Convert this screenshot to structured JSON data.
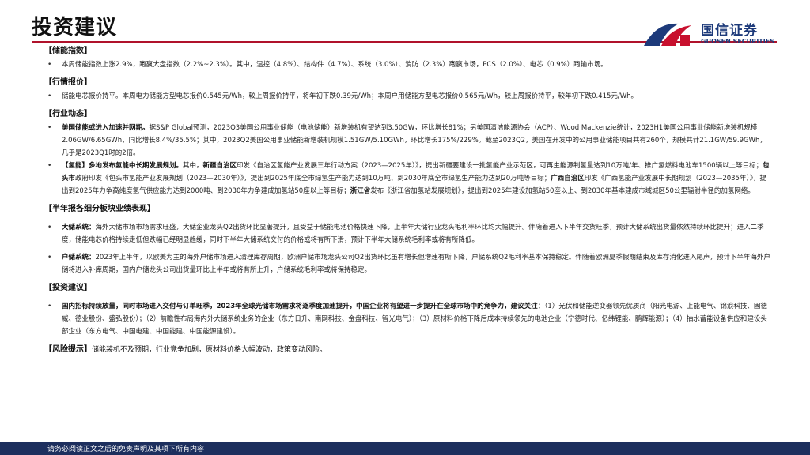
{
  "page": {
    "title": "投资建议"
  },
  "logo": {
    "cn": "国信证券",
    "en": "GUOSEN SECURITIES"
  },
  "sections": {
    "s1": {
      "head": "【储能指数】",
      "text": "本周储能指数上涨2.9%，跑赢大盘指数（2.2%~2.3%）。其中，温控（4.8%）、结构件（4.7%）、系统（3.0%）、消防（2.3%）跑赢市场，PCS（2.0%）、电芯（0.9%）跑输市场。"
    },
    "s2": {
      "head": "【行情报价】",
      "text": "储能电芯报价持平。本周电力储能方型电芯报价0.545元/Wh，较上周报价持平，将年初下跌0.39元/Wh；本周户用储能方型电芯报价0.565元/Wh，较上周报价持平，较年初下跌0.415元/Wh。"
    },
    "s3": {
      "head": "【行业动态】",
      "item1_bold": "美国储能或进入加速并网期。",
      "item1_text": "据S&P Global预测，2023Q3美国公用事业储能（电池储能）新增装机有望达到3.50GW，环比增长81%；另美国清洁能源协会（ACP）、Wood Mackenzie统计，2023H1美国公用事业储能新增装机规模2.06GW/6.65GWh，同比增长8.4%/35.5%；其中，2023Q2美国公用事业储能新增装机规模1.51GW/5.10GWh，环比增长175%/229%。截至2023Q2，美国在开发中的公用事业储能项目共有260个，规模共计21.1GW/59.9GWh，几乎是2023Q1时的2倍。",
      "item2_a": "【氢能】多地发布氢能中长期发展规划。",
      "item2_b": "其中，",
      "item2_c": "新疆自治区",
      "item2_d": "印发《自治区氢能产业发展三年行动方案（2023—2025年）》，提出新疆要建设一批氢能产业示范区，可再生能源制氢量达到10万吨/年、推广氢燃料电池车1500辆以上等目标；",
      "item2_e": "包头市",
      "item2_f": "政府印发《包头市氢能产业发展规划（2023—2030年）》，提出到2025年底全市绿氢生产能力达到10万吨、到2030年底全市绿氢生产能力达到20万吨等目标；",
      "item2_g": "广西自治区",
      "item2_h": "印发《广西氢能产业发展中长期规划（2023—2035年）》，提出到2025年力争高纯度氢气供应能力达到2000吨、到2030年力争建成加氢站50座以上等目标；",
      "item2_i": "浙江省",
      "item2_j": "发布《浙江省加氢站发展规划》，提出到2025年建设加氢站50座以上、到2030年基本建成市域城区50公里辐射半径的加氢网络。"
    },
    "s4": {
      "head": "【半年报各细分板块业绩表现】",
      "item1_bold": "大储系统：",
      "item1_text": "海外大储市场市场需求旺盛，大储企业龙头Q2出货环比显著提升，且受益于储能电池价格快速下降，上半年大储行业龙头毛利率环比均大幅提升。伴随着进入下半年交货旺季，预计大储系统出货量依然持续环比提升；进入二季度，储能电芯价格持续走低但跌幅已经明显趋缓，同时下半年大储系统交付的价格或将有所下滑，预计下半年大储系统毛利率或将有所降低。",
      "item2_bold": "户储系统：",
      "item2_text": "2023年上半年，以欧美为主的海外户储市场进入清理库存周期，欧洲户储市场龙头公司Q2出货环比虽有增长但增速有所下降，户储系统Q2毛利率基本保持稳定。伴随着欧洲夏季假期结束及库存消化进入尾声，预计下半年海外户储将进入补库周期，国内户储龙头公司出货量环比上半年或将有所上升，户储系统毛利率或将保持稳定。"
    },
    "s5": {
      "head": "【投资建议】",
      "item1_bold": "国内招标持续放量，同时市场进入交付与订单旺季，2023年全球光储市场需求将逐季度加速提升，中国企业将有望进一步提升在全球市场中的竞争力，建议关注：",
      "item1_text": "（1）光伏和储能逆变器领先优质商（阳光电源、上能电气、锦浪科技、固德威、德业股份、盛弘股份）；（2）前瞻性布局海内外大储系统业务的企业（东方日升、南网科技、金盘科技、智光电气）；（3）原材料价格下降后成本持续领先的电池企业（宁德时代、亿纬锂能、鹏辉能源）；（4）抽水蓄能设备供应和建设头部企业（东方电气、中国电建、中国能建、中国能源建设）。"
    },
    "s6": {
      "head": "【风险提示】",
      "text": "储能装机不及预期，行业竞争加剧，原材料价格大幅波动，政策变动风险。"
    }
  },
  "footer": {
    "text": "请务必阅读正文之后的免责声明及其项下所有内容"
  },
  "colors": {
    "accent_red": "#b0122b",
    "brand_blue": "#1d3a7a",
    "footer_bg": "#1d2f5e"
  }
}
